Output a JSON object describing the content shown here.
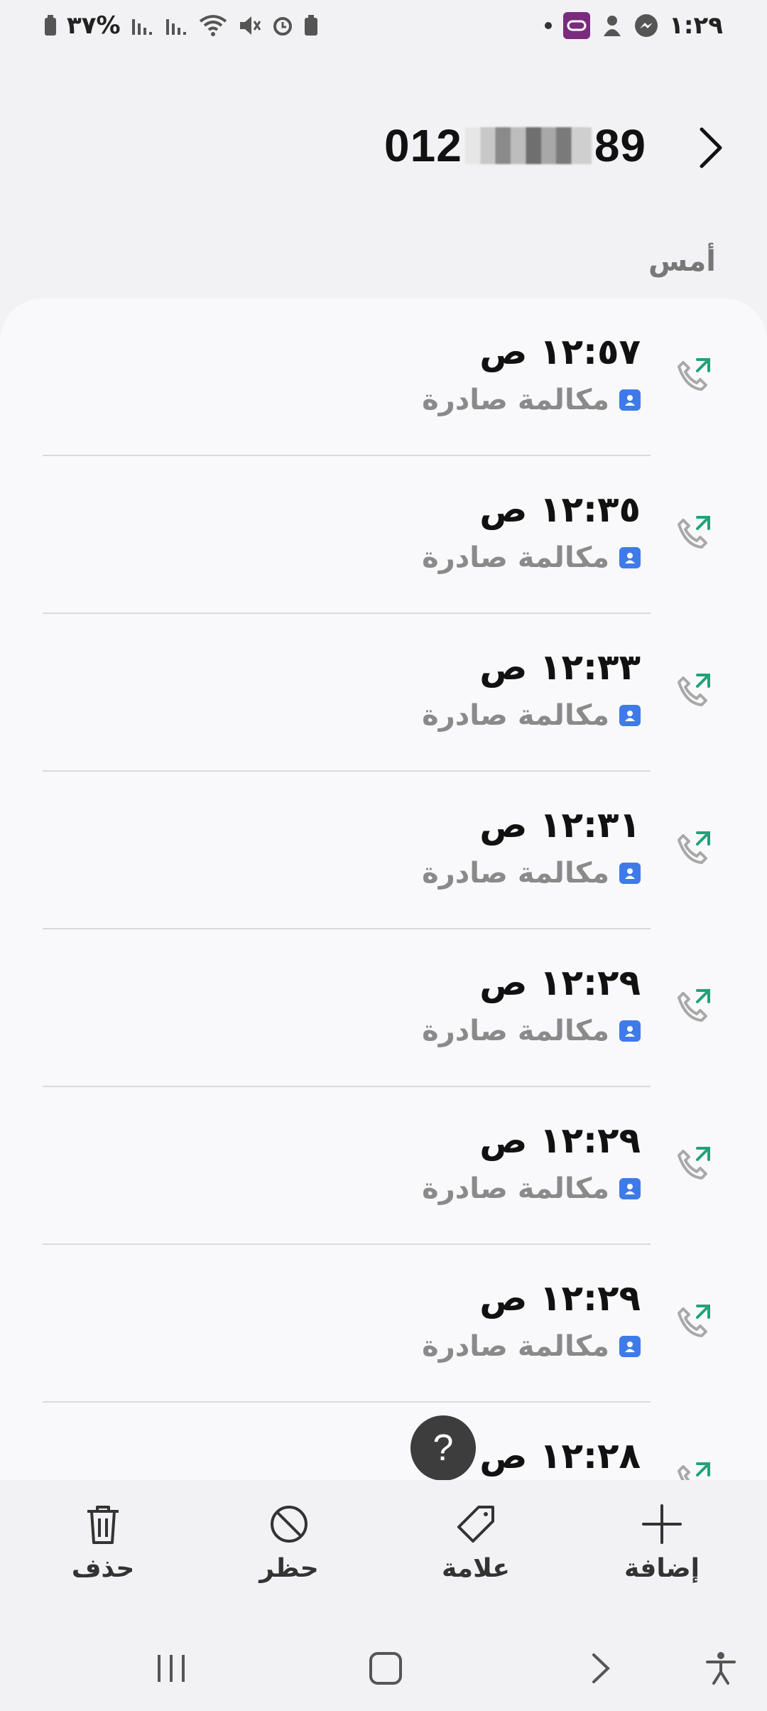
{
  "status_bar": {
    "time": "١:٢٩",
    "battery": "٣٧%"
  },
  "header": {
    "phone_prefix": "012",
    "phone_suffix": "89",
    "section_label": "أمس"
  },
  "calls": [
    {
      "time": "١٢:٥٧ ص",
      "type": "مكالمة صادرة"
    },
    {
      "time": "١٢:٣٥ ص",
      "type": "مكالمة صادرة"
    },
    {
      "time": "١٢:٣٣ ص",
      "type": "مكالمة صادرة"
    },
    {
      "time": "١٢:٣١ ص",
      "type": "مكالمة صادرة"
    },
    {
      "time": "١٢:٢٩ ص",
      "type": "مكالمة صادرة"
    },
    {
      "time": "١٢:٢٩ ص",
      "type": "مكالمة صادرة"
    },
    {
      "time": "١٢:٢٩ ص",
      "type": "مكالمة صادرة"
    },
    {
      "time": "١٢:٢٨ ص",
      "type": ""
    }
  ],
  "help_label": "?",
  "actions": {
    "add": "إضافة",
    "tag": "علامة",
    "block": "حظر",
    "delete": "حذف"
  },
  "colors": {
    "outgoing_arrow": "#1fa37a",
    "contact_badge": "#3e7be8"
  }
}
